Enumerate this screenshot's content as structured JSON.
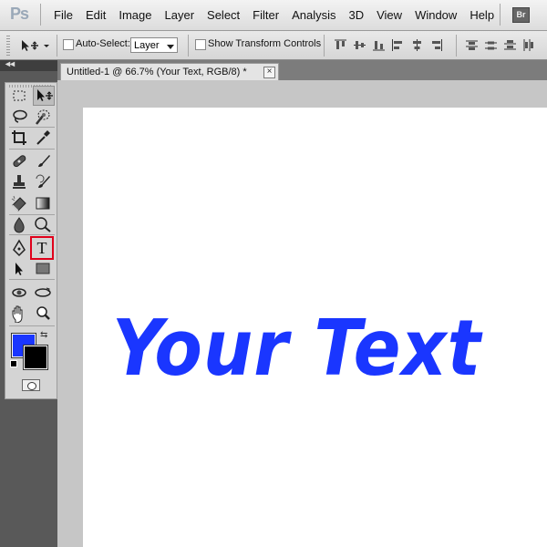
{
  "app": {
    "logo": "Ps",
    "bridge_button": "Br"
  },
  "menu": [
    "File",
    "Edit",
    "Image",
    "Layer",
    "Select",
    "Filter",
    "Analysis",
    "3D",
    "View",
    "Window",
    "Help"
  ],
  "options_bar": {
    "auto_select_label": "Auto-Select:",
    "auto_select_checked": false,
    "auto_select_value": "Layer",
    "show_transform_label": "Show Transform Controls",
    "show_transform_checked": false
  },
  "document": {
    "tab_title": "Untitled-1 @ 66.7% (Your Text, RGB/8) *",
    "close_glyph": "×",
    "canvas_text": "Your Text",
    "text_color": "#1a36ff"
  },
  "toolbox": {
    "collapse_glyph": "◂◂",
    "active_tool": "move-tool",
    "highlighted_tool": "type-tool",
    "type_tool_glyph": "T",
    "swap_glyph": "⇆",
    "foreground_color": "#1a36ff",
    "background_color": "#000000"
  },
  "colors": {
    "highlight_outline": "#e0001b"
  }
}
